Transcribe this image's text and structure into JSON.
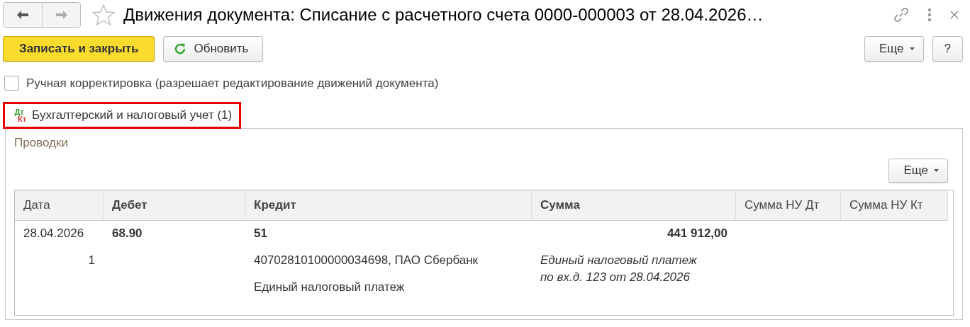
{
  "window": {
    "title": "Движения документа: Списание с расчетного счета 0000-000003 от 28.04.2026…",
    "favorite": false
  },
  "nav": {
    "back_disabled": false,
    "forward_disabled": true
  },
  "toolbar": {
    "primary": "Записать и закрыть",
    "refresh": "Обновить",
    "more": "Еще",
    "help": "?"
  },
  "manual_correction": {
    "label": "Ручная корректировка (разрешает редактирование движений документа)",
    "checked": false
  },
  "tabs": [
    {
      "label": "Бухгалтерский и налоговый учет (1)",
      "icon_top": "Дт",
      "icon_bottom": "Кт",
      "selected": true,
      "highlighted": true
    }
  ],
  "panel": {
    "title": "Проводки",
    "more": "Еще",
    "table": {
      "columns": [
        {
          "label": "Дата",
          "bold": false
        },
        {
          "label": "Дебет",
          "bold": true
        },
        {
          "label": "Кредит",
          "bold": true
        },
        {
          "label": "Сумма",
          "bold": true
        },
        {
          "label": "Сумма НУ Дт",
          "bold": false
        },
        {
          "label": "Сумма НУ Кт",
          "bold": false
        }
      ],
      "rows": [
        {
          "date": "28.04.2026",
          "number": "1",
          "debit": "68.90",
          "credit": "51",
          "credit_details": [
            "40702810100000034698, ПАО Сбербанк",
            "Единый налоговый платеж"
          ],
          "amount": "441 912,00",
          "amount_content": [
            "Единый налоговый платеж",
            "по вх.д. 123 от 28.04.2026"
          ]
        }
      ]
    }
  }
}
